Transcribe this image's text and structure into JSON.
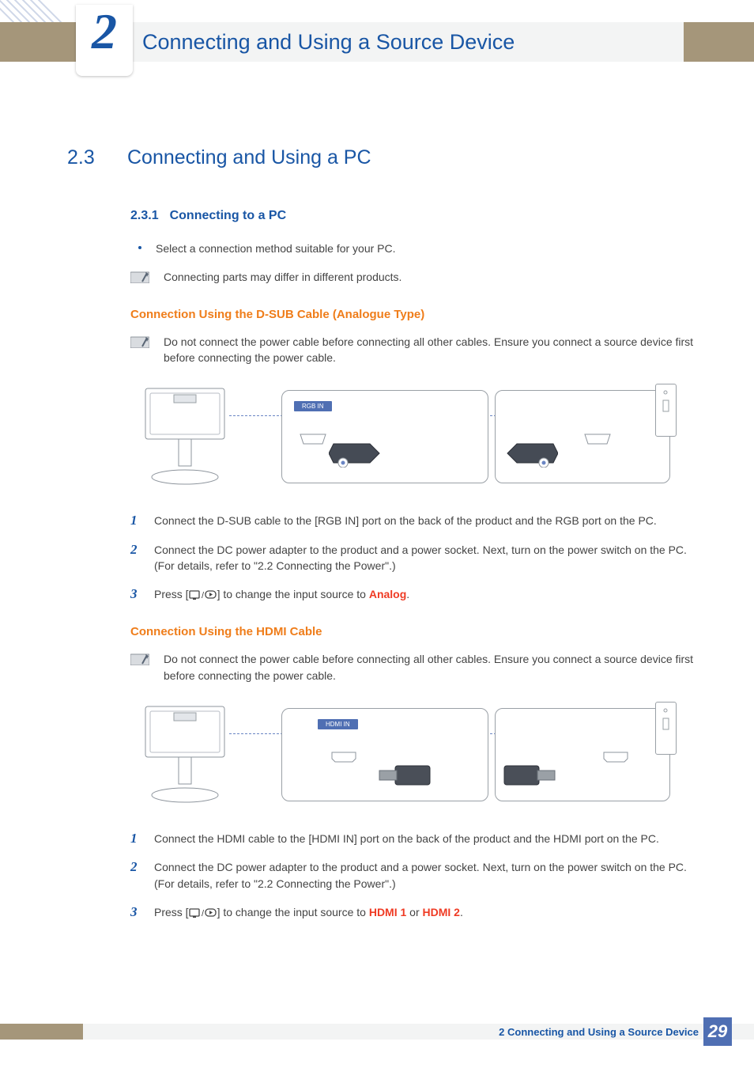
{
  "chapter": {
    "number": "2",
    "title": "Connecting and Using a Source Device"
  },
  "section": {
    "number": "2.3",
    "title": "Connecting and Using a PC"
  },
  "subsection": {
    "number": "2.3.1",
    "title": "Connecting to a PC",
    "bullet": "Select a connection method suitable for your PC.",
    "note": "Connecting parts may differ in different products."
  },
  "dsub": {
    "heading": "Connection Using the D-SUB Cable (Analogue Type)",
    "warning": "Do not connect the power cable before connecting all other cables. Ensure you connect a source device first before connecting the power cable.",
    "port_label": "RGB IN",
    "steps": {
      "s1": "Connect the D-SUB cable to the [RGB IN] port on the back of the product and the RGB port on the PC.",
      "s2": "Connect the DC power adapter to the product and a power socket. Next, turn on the power switch on the PC. (For details, refer to \"2.2 Connecting the Power\".)",
      "s3_pre": "Press [",
      "s3_mid": "] to change the input source to ",
      "s3_hl": "Analog",
      "s3_post": "."
    }
  },
  "hdmi": {
    "heading": "Connection Using the HDMI Cable",
    "warning": "Do not connect the power cable before connecting all other cables. Ensure you connect a source device first before connecting the power cable.",
    "port_label": "HDMI IN",
    "steps": {
      "s1": "Connect the HDMI cable to the [HDMI IN] port on the back of the product and the HDMI port on the PC.",
      "s2": "Connect the DC power adapter to the product and a power socket. Next, turn on the power switch on the PC. (For details, refer to \"2.2 Connecting the Power\".)",
      "s3_pre": "Press [",
      "s3_mid": "] to change the input source to ",
      "s3_hl1": "HDMI 1",
      "s3_or": " or ",
      "s3_hl2": "HDMI 2",
      "s3_post": "."
    }
  },
  "footer": {
    "text": "2 Connecting and Using a Source Device",
    "page": "29"
  }
}
